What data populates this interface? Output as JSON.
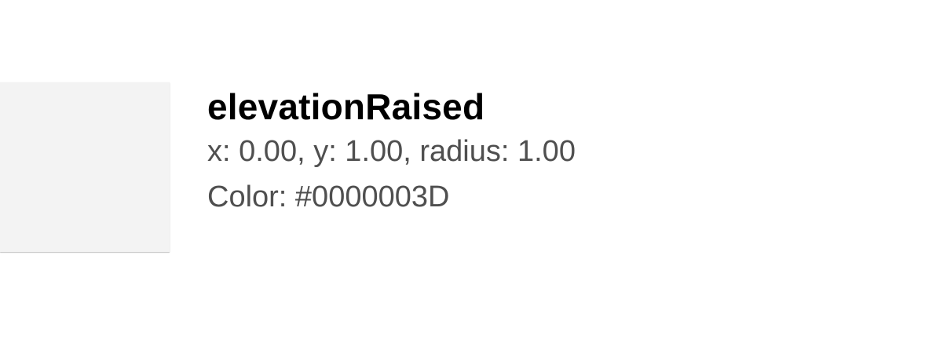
{
  "token": {
    "name": "elevationRaised",
    "geometry_text": "x: 0.00, y: 1.00, radius: 1.00",
    "color_text": "Color: #0000003D"
  },
  "colors": {
    "swatch_fill": "#f3f3f3",
    "shadow_color": "#0000003D",
    "title_text": "#000000",
    "detail_text": "#4f4f4f"
  }
}
